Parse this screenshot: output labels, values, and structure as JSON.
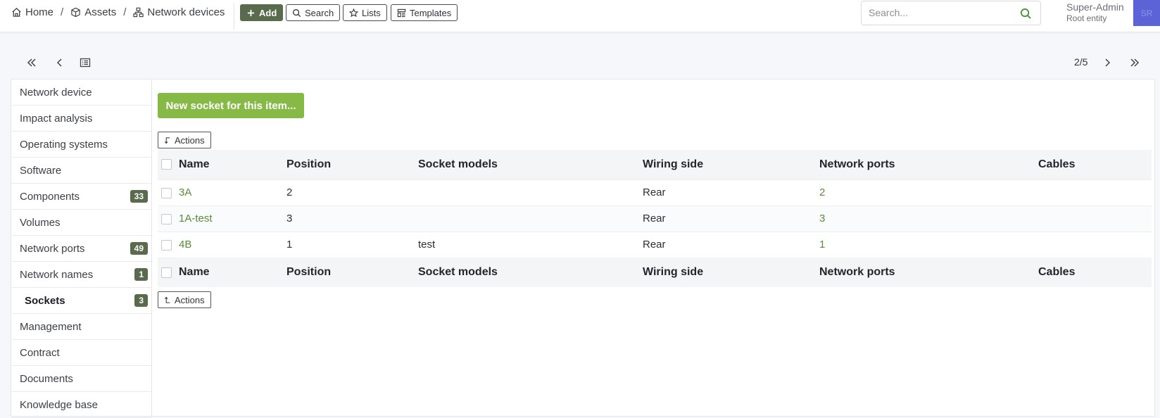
{
  "breadcrumb": {
    "home": "Home",
    "assets": "Assets",
    "network_devices": "Network devices",
    "sep": "/"
  },
  "toolbar": {
    "add": "Add",
    "search": "Search",
    "lists": "Lists",
    "templates": "Templates"
  },
  "search": {
    "placeholder": "Search..."
  },
  "user": {
    "name": "Super-Admin",
    "entity": "Root entity",
    "initials": "SR"
  },
  "pager": {
    "text": "2/5"
  },
  "sidetabs": [
    {
      "label": "Network device",
      "badge": ""
    },
    {
      "label": "Impact analysis",
      "badge": ""
    },
    {
      "label": "Operating systems",
      "badge": ""
    },
    {
      "label": "Software",
      "badge": ""
    },
    {
      "label": "Components",
      "badge": "33"
    },
    {
      "label": "Volumes",
      "badge": ""
    },
    {
      "label": "Network ports",
      "badge": "49"
    },
    {
      "label": "Network names",
      "badge": "1"
    },
    {
      "label": "Sockets",
      "badge": "3"
    },
    {
      "label": "Management",
      "badge": ""
    },
    {
      "label": "Contract",
      "badge": ""
    },
    {
      "label": "Documents",
      "badge": ""
    },
    {
      "label": "Knowledge base",
      "badge": ""
    }
  ],
  "active_tab": "Sockets",
  "main": {
    "new_button": "New socket for this item...",
    "actions_label": "Actions",
    "columns": [
      "Name",
      "Position",
      "Socket models",
      "Wiring side",
      "Network ports",
      "Cables"
    ],
    "rows": [
      {
        "name": "3A",
        "position": "2",
        "socket_model": "",
        "wiring_side": "Rear",
        "network_ports": "2",
        "cables": ""
      },
      {
        "name": "1A-test",
        "position": "3",
        "socket_model": "",
        "wiring_side": "Rear",
        "network_ports": "3",
        "cables": ""
      },
      {
        "name": "4B",
        "position": "1",
        "socket_model": "test",
        "wiring_side": "Rear",
        "network_ports": "1",
        "cables": ""
      }
    ]
  },
  "colors": {
    "accent_green": "#86b946",
    "link_green": "#5b8a3a",
    "badge_green": "#5a6a4c",
    "avatar": "#5b63d6"
  }
}
